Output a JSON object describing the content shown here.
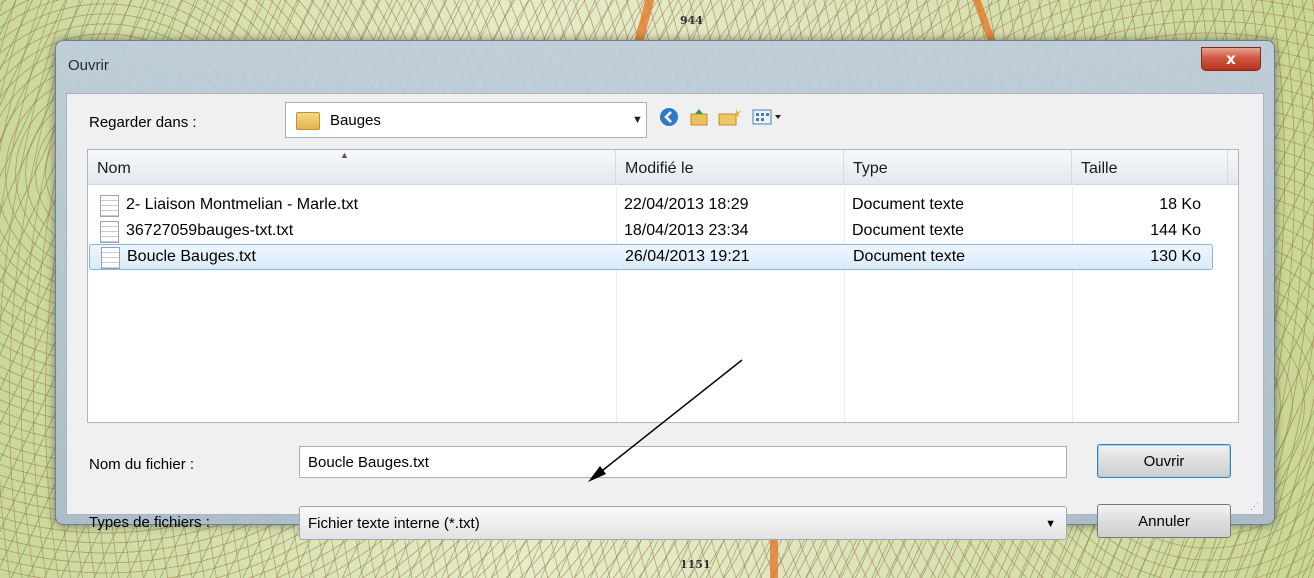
{
  "dialog": {
    "title": "Ouvrir",
    "close_glyph": "x"
  },
  "toolbar": {
    "look_in_label": "Regarder dans :",
    "current_folder": "Bauges",
    "icons": [
      "back-icon",
      "up-folder-icon",
      "new-folder-icon",
      "view-menu-icon"
    ]
  },
  "list": {
    "columns": [
      "Nom",
      "Modifié le",
      "Type",
      "Taille"
    ],
    "rows": [
      {
        "name": "2- Liaison Montmelian - Marle.txt",
        "modified": "22/04/2013 18:29",
        "type": "Document texte",
        "size": "18 Ko",
        "selected": false
      },
      {
        "name": "36727059bauges-txt.txt",
        "modified": "18/04/2013 23:34",
        "type": "Document texte",
        "size": "144 Ko",
        "selected": false
      },
      {
        "name": "Boucle Bauges.txt",
        "modified": "26/04/2013 19:21",
        "type": "Document texte",
        "size": "130 Ko",
        "selected": true
      }
    ]
  },
  "file_name": {
    "label": "Nom du fichier :",
    "value": "Boucle Bauges.txt"
  },
  "file_type": {
    "label": "Types de fichiers :",
    "value": "Fichier texte interne (*.txt)"
  },
  "buttons": {
    "open": "Ouvrir",
    "cancel": "Annuler"
  },
  "map": {
    "labels": [
      "944",
      "1151"
    ]
  },
  "colors": {
    "selection": "#d9ebfa",
    "close_button": "#c8412a",
    "annotation_arrow": "#000000"
  }
}
